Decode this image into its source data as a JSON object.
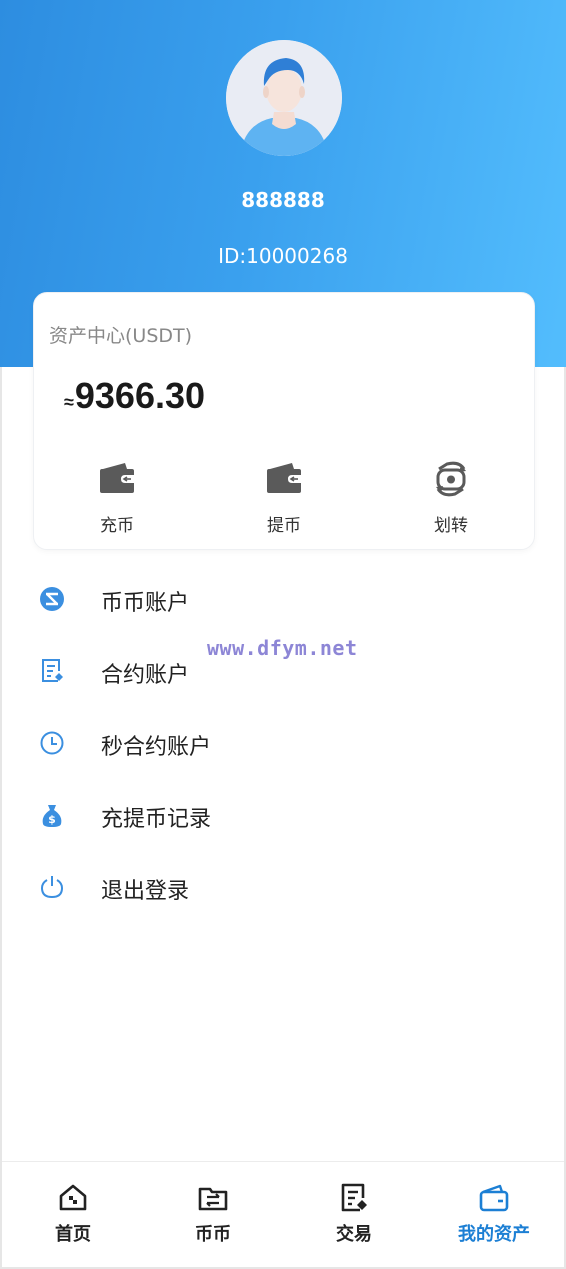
{
  "profile": {
    "username": "888888",
    "user_id": "ID:10000268"
  },
  "asset_card": {
    "title": "资产中心(USDT)",
    "approx_symbol": "≈",
    "balance": "9366.30",
    "actions": [
      {
        "label": "充币",
        "icon": "wallet-icon"
      },
      {
        "label": "提币",
        "icon": "wallet-icon"
      },
      {
        "label": "划转",
        "icon": "transfer-icon"
      }
    ]
  },
  "menu": [
    {
      "label": "币币账户",
      "icon": "coin-account-icon"
    },
    {
      "label": "合约账户",
      "icon": "contract-icon"
    },
    {
      "label": "秒合约账户",
      "icon": "clock-icon"
    },
    {
      "label": "充提币记录",
      "icon": "money-bag-icon"
    },
    {
      "label": "退出登录",
      "icon": "power-icon"
    }
  ],
  "watermark": "www.dfym.net",
  "tabbar": [
    {
      "label": "首页",
      "icon": "home-icon",
      "active": false
    },
    {
      "label": "币币",
      "icon": "exchange-folder-icon",
      "active": false
    },
    {
      "label": "交易",
      "icon": "trade-document-icon",
      "active": false
    },
    {
      "label": "我的资产",
      "icon": "wallet-icon",
      "active": true
    }
  ],
  "colors": {
    "header_gradient_start": "#2d8de0",
    "header_gradient_end": "#53bdfd",
    "accent_blue": "#1c7fd4",
    "icon_blue": "#3b8fe0",
    "action_icon_gray": "#5a5a5a"
  }
}
